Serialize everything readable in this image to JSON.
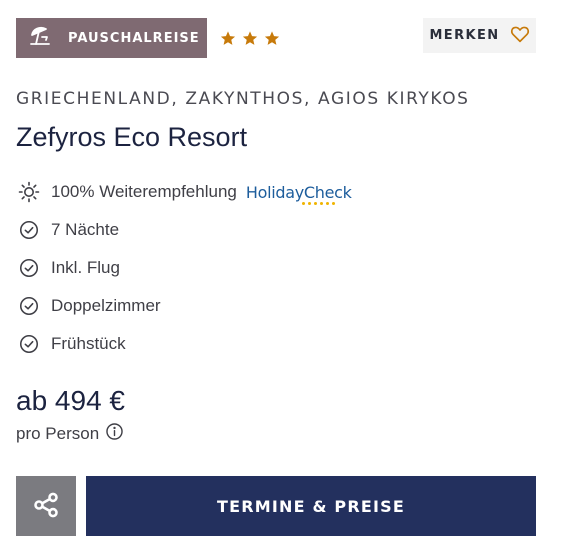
{
  "badge": {
    "label": "PAUSCHALREISE",
    "icon": "beach-umbrella-icon",
    "color": "#7f6a72"
  },
  "rating": {
    "stars": 3,
    "color": "#c77a0a"
  },
  "bookmark": {
    "label": "MERKEN",
    "icon": "heart-outline-icon"
  },
  "location": "GRIECHENLAND, ZAKYNTHOS, AGIOS KIRYKOS",
  "hotel_name": "Zefyros Eco Resort",
  "recommendation": {
    "text": "100% Weiterempfehlung",
    "provider": "HolidayCheck",
    "icon": "sun-icon"
  },
  "features": [
    {
      "label": "7 Nächte",
      "icon": "check-circle-icon"
    },
    {
      "label": "Inkl. Flug",
      "icon": "check-circle-icon"
    },
    {
      "label": "Doppelzimmer",
      "icon": "check-circle-icon"
    },
    {
      "label": "Frühstück",
      "icon": "check-circle-icon"
    }
  ],
  "price": {
    "text": "ab 494 €",
    "per": "pro Person",
    "info_icon": "info-icon"
  },
  "actions": {
    "share_icon": "share-icon",
    "cta_label": "TERMINE & PREISE",
    "cta_color": "#23305e"
  }
}
